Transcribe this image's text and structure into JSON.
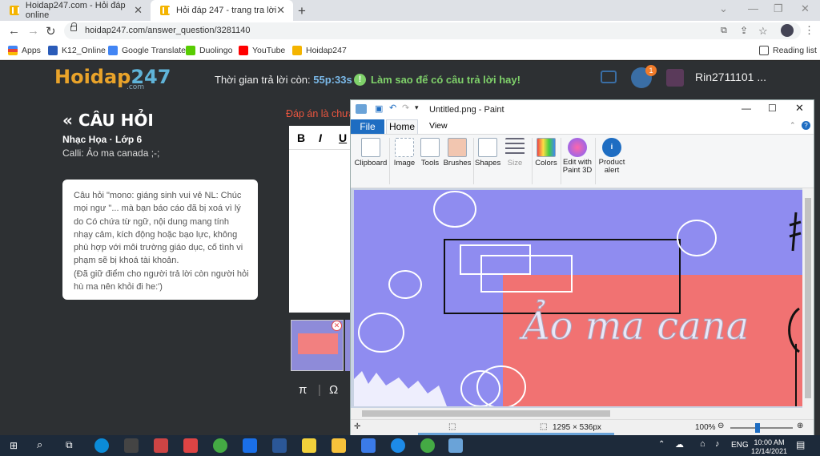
{
  "browser": {
    "tabs": [
      {
        "title": "Hoidap247.com - Hỏi đáp online"
      },
      {
        "title": "Hỏi đáp 247 - trang tra lời"
      }
    ],
    "url": "hoidap247.com/answer_question/3281140",
    "bookmarks": [
      "Apps",
      "K12_Online",
      "Google Translate",
      "Duolingo",
      "YouTube",
      "Hoidap247"
    ],
    "reading_list": "Reading list"
  },
  "site": {
    "logo_main": "Hoidap",
    "logo_num": "247",
    "logo_sub": ".com",
    "timer_label": "Thời gian trả lời còn:",
    "timer_value": "55p:33s",
    "tip": "Làm sao để có câu trả lời hay!",
    "notif_count": "1",
    "username": "Rin2711101 ..."
  },
  "question": {
    "title": "CÂU HỎI",
    "subject": "Nhạc Họa · Lớp 6",
    "meta": "Calli: Ảo ma canada ;-;",
    "notice": "Câu hỏi \"mono: giáng sinh vui vẻ NL: Chúc mọi ngư \"... mà bạn báo cáo đã bị xoá vì lý do Có chứa từ ngữ, nội dung mang tính nhạy cảm, kích động hoặc bạo lực, không phù hợp với môi trường giáo dục, cố tình vi phạm sẽ bị khoá tài khoản.",
    "notice2": "(Đã giữ điểm cho người trả lời còn người hỏi hù ma nên khỏi đi he:')",
    "answer_label": "Đáp án là chưa",
    "editor_buttons": [
      "B",
      "I",
      "U"
    ],
    "symbols": [
      "π",
      "|",
      "Ω"
    ]
  },
  "paint": {
    "title": "Untitled.png - Paint",
    "menu": {
      "file": "File",
      "home": "Home",
      "view": "View"
    },
    "groups": [
      "Clipboard",
      "Image",
      "Tools",
      "Brushes",
      "Shapes",
      "Size",
      "Colors",
      "Edit with Paint 3D",
      "Product alert"
    ],
    "canvas_text": "Ảo ma cana",
    "dimensions": "1295 × 536px",
    "zoom": "100%"
  },
  "taskbar": {
    "lang": "ENG",
    "time": "10:00 AM",
    "date": "12/14/2021"
  }
}
